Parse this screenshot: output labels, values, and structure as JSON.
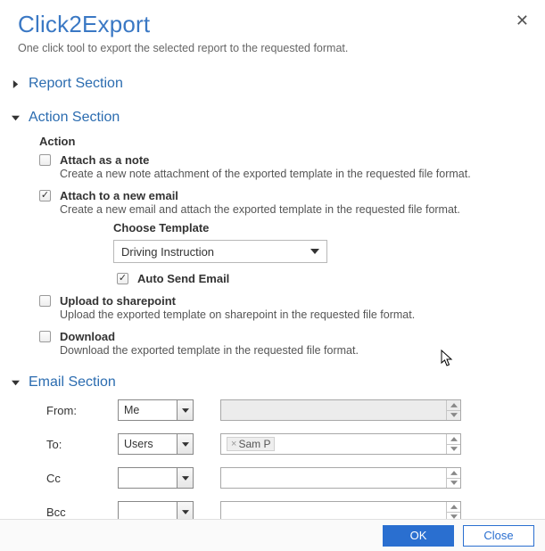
{
  "header": {
    "title": "Click2Export",
    "subtitle": "One click tool to export the selected report to the requested format."
  },
  "sections": {
    "report": {
      "title": "Report Section",
      "expanded": false
    },
    "action": {
      "title": "Action Section",
      "expanded": true,
      "heading": "Action",
      "options": {
        "note": {
          "label": "Attach as a note",
          "desc": "Create a new note attachment of the exported template in the requested file format.",
          "checked": false
        },
        "email": {
          "label": "Attach to a new email",
          "desc": "Create a new email and attach the exported template in the requested file format.",
          "checked": true,
          "template_label": "Choose Template",
          "template_value": "Driving Instruction",
          "autosend_checked": true,
          "autosend_label": "Auto Send Email"
        },
        "sharepoint": {
          "label": "Upload to sharepoint",
          "desc": "Upload the exported template on sharepoint in the requested file format.",
          "checked": false
        },
        "download": {
          "label": "Download",
          "desc": "Download the exported template in the requested file format.",
          "checked": false
        }
      }
    },
    "emailSection": {
      "title": "Email Section",
      "expanded": true,
      "fields": {
        "from": {
          "label": "From:",
          "source": "Me",
          "value": ""
        },
        "to": {
          "label": "To:",
          "source": "Users",
          "chip": "Sam P"
        },
        "cc": {
          "label": "Cc",
          "source": "",
          "value": ""
        },
        "bcc": {
          "label": "Bcc",
          "source": "",
          "value": ""
        }
      }
    }
  },
  "footer": {
    "ok": "OK",
    "close": "Close"
  }
}
